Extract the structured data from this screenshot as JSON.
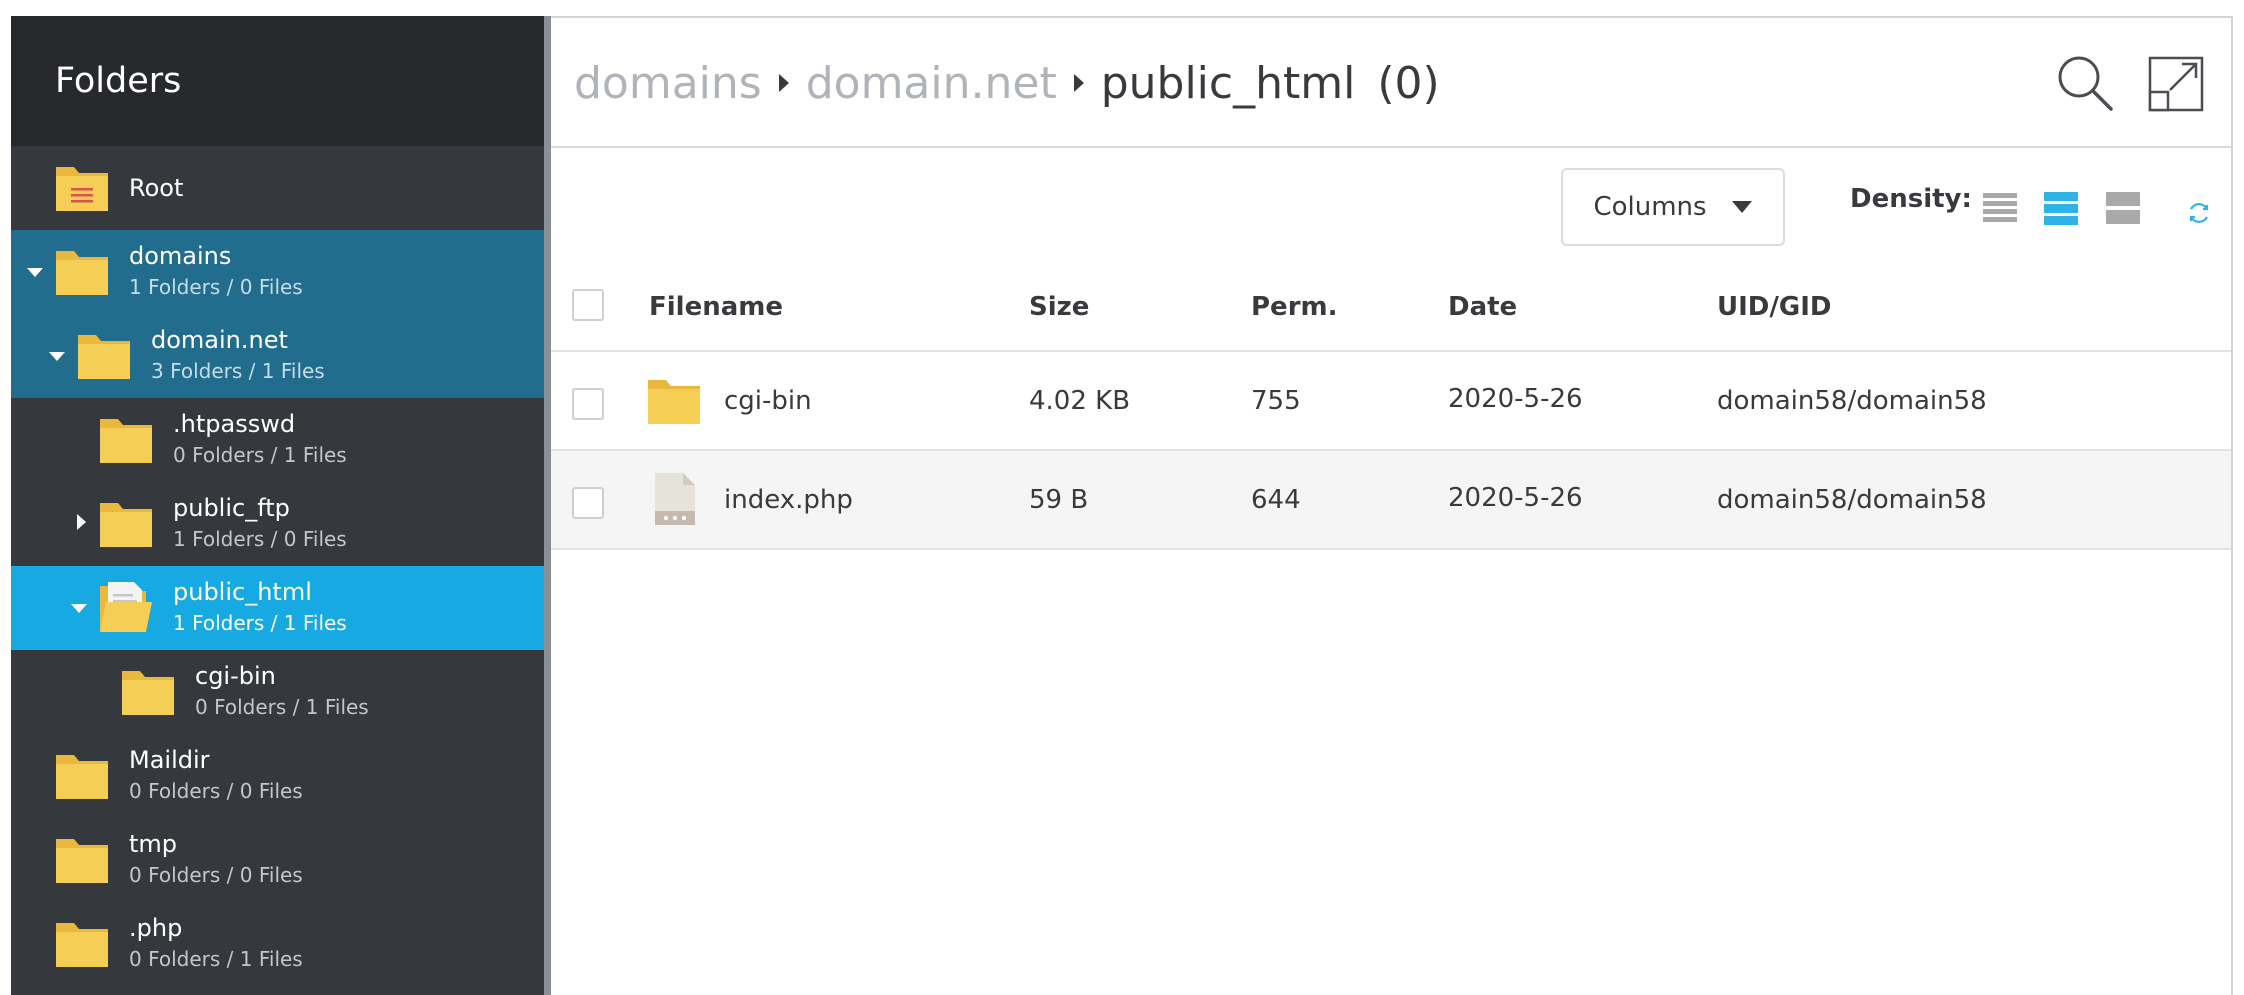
{
  "sidebar": {
    "header": "Folders",
    "items": [
      {
        "name": "Root",
        "sub": ""
      },
      {
        "name": "domains",
        "sub": "1 Folders / 0 Files"
      },
      {
        "name": "domain.net",
        "sub": "3 Folders / 1 Files"
      },
      {
        "name": ".htpasswd",
        "sub": "0 Folders / 1 Files"
      },
      {
        "name": "public_ftp",
        "sub": "1 Folders / 0 Files"
      },
      {
        "name": "public_html",
        "sub": "1 Folders / 1 Files"
      },
      {
        "name": "cgi-bin",
        "sub": "0 Folders / 1 Files"
      },
      {
        "name": "Maildir",
        "sub": "0 Folders / 0 Files"
      },
      {
        "name": "tmp",
        "sub": "0 Folders / 0 Files"
      },
      {
        "name": ".php",
        "sub": "0 Folders / 1 Files"
      }
    ]
  },
  "breadcrumb": {
    "parts": [
      "domains",
      "domain.net"
    ],
    "current": "public_html",
    "count": "(0)"
  },
  "toolbar": {
    "columns_label": "Columns",
    "density_label": "Density:"
  },
  "table": {
    "headers": {
      "filename": "Filename",
      "size": "Size",
      "perm": "Perm.",
      "date": "Date",
      "uid": "UID/GID"
    },
    "rows": [
      {
        "name": "cgi-bin",
        "size": "4.02 KB",
        "perm": "755",
        "date": "2020-5-26",
        "uid": "domain58/domain58",
        "icon": "folder-icon"
      },
      {
        "name": "index.php",
        "size": "59 B",
        "perm": "644",
        "date": "2020-5-26",
        "uid": "domain58/domain58",
        "icon": "file-icon"
      }
    ]
  },
  "colors": {
    "sidebar_bg": "#35383d",
    "sidebar_header_bg": "#27292c",
    "selected_path_bg": "#226d8e",
    "active_bg": "#16a9e2",
    "folder_yellow": "#f5cf55",
    "accent": "#2fb2e8"
  }
}
